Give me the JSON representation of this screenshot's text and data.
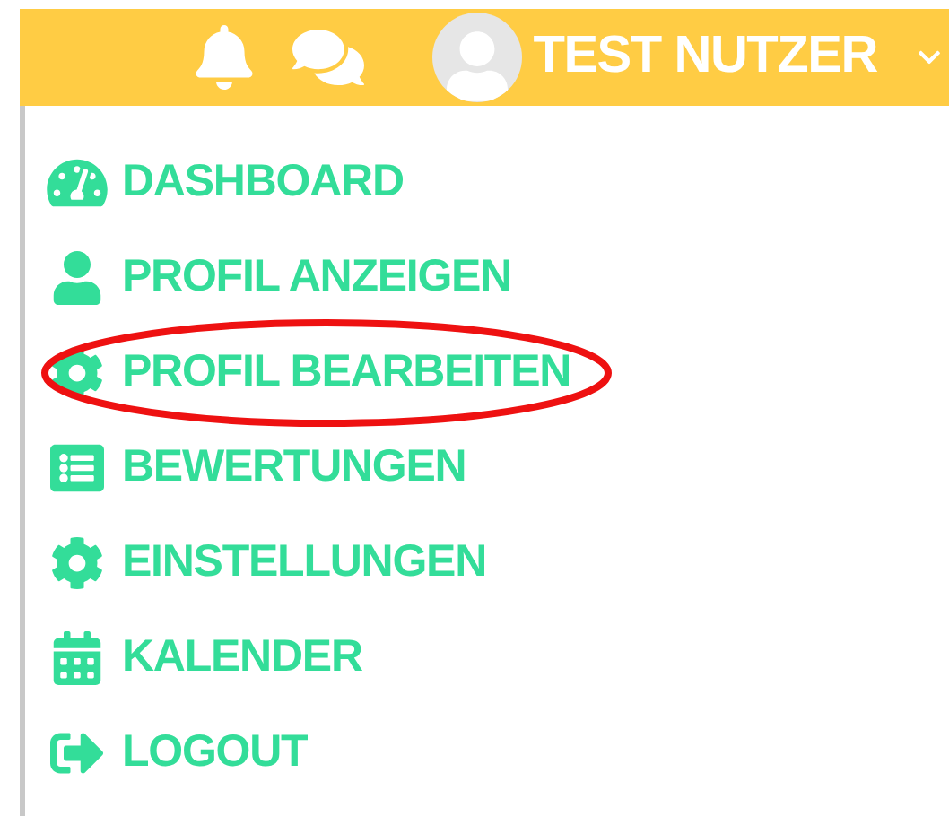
{
  "header": {
    "user_name": "TEST NUTZER"
  },
  "menu": [
    {
      "kind": "dashboard",
      "label": "DASHBOARD",
      "highlighted": false
    },
    {
      "kind": "profile",
      "label": "PROFIL ANZEIGEN",
      "highlighted": false
    },
    {
      "kind": "edit",
      "label": "PROFIL BEARBEITEN",
      "highlighted": true
    },
    {
      "kind": "reviews",
      "label": "BEWERTUNGEN",
      "highlighted": false
    },
    {
      "kind": "settings",
      "label": "EINSTELLUNGEN",
      "highlighted": false
    },
    {
      "kind": "calendar",
      "label": "KALENDER",
      "highlighted": false
    },
    {
      "kind": "logout",
      "label": "LOGOUT",
      "highlighted": false
    }
  ]
}
